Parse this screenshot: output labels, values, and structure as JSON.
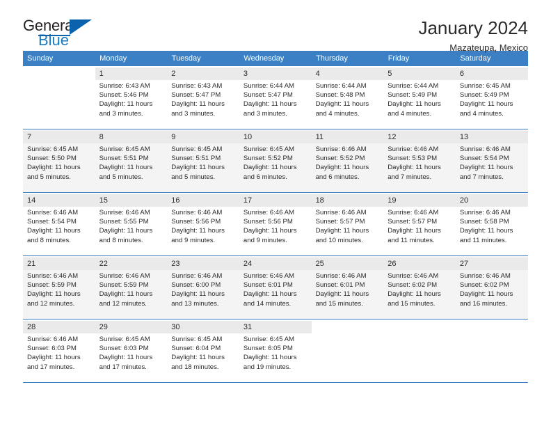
{
  "logo": {
    "primary": "General",
    "secondary": "Blue",
    "triangle_color": "#0b63ad",
    "secondary_color": "#1c7ac0"
  },
  "header": {
    "title": "January 2024",
    "subtitle": "Mazateupa, Mexico"
  },
  "theme": {
    "header_row_bg": "#3b80c4",
    "header_row_text": "#ffffff",
    "shaded_row_bg": "#f4f4f4",
    "daynum_bg": "#eaeaea",
    "grid_line": "#3b80c4"
  },
  "weekdays": [
    "Sunday",
    "Monday",
    "Tuesday",
    "Wednesday",
    "Thursday",
    "Friday",
    "Saturday"
  ],
  "weeks": [
    [
      {
        "day": "",
        "lines": []
      },
      {
        "day": "1",
        "lines": [
          "Sunrise: 6:43 AM",
          "Sunset: 5:46 PM",
          "Daylight: 11 hours",
          "and 3 minutes."
        ]
      },
      {
        "day": "2",
        "lines": [
          "Sunrise: 6:43 AM",
          "Sunset: 5:47 PM",
          "Daylight: 11 hours",
          "and 3 minutes."
        ]
      },
      {
        "day": "3",
        "lines": [
          "Sunrise: 6:44 AM",
          "Sunset: 5:47 PM",
          "Daylight: 11 hours",
          "and 3 minutes."
        ]
      },
      {
        "day": "4",
        "lines": [
          "Sunrise: 6:44 AM",
          "Sunset: 5:48 PM",
          "Daylight: 11 hours",
          "and 4 minutes."
        ]
      },
      {
        "day": "5",
        "lines": [
          "Sunrise: 6:44 AM",
          "Sunset: 5:49 PM",
          "Daylight: 11 hours",
          "and 4 minutes."
        ]
      },
      {
        "day": "6",
        "lines": [
          "Sunrise: 6:45 AM",
          "Sunset: 5:49 PM",
          "Daylight: 11 hours",
          "and 4 minutes."
        ]
      }
    ],
    [
      {
        "day": "7",
        "lines": [
          "Sunrise: 6:45 AM",
          "Sunset: 5:50 PM",
          "Daylight: 11 hours",
          "and 5 minutes."
        ]
      },
      {
        "day": "8",
        "lines": [
          "Sunrise: 6:45 AM",
          "Sunset: 5:51 PM",
          "Daylight: 11 hours",
          "and 5 minutes."
        ]
      },
      {
        "day": "9",
        "lines": [
          "Sunrise: 6:45 AM",
          "Sunset: 5:51 PM",
          "Daylight: 11 hours",
          "and 5 minutes."
        ]
      },
      {
        "day": "10",
        "lines": [
          "Sunrise: 6:45 AM",
          "Sunset: 5:52 PM",
          "Daylight: 11 hours",
          "and 6 minutes."
        ]
      },
      {
        "day": "11",
        "lines": [
          "Sunrise: 6:46 AM",
          "Sunset: 5:52 PM",
          "Daylight: 11 hours",
          "and 6 minutes."
        ]
      },
      {
        "day": "12",
        "lines": [
          "Sunrise: 6:46 AM",
          "Sunset: 5:53 PM",
          "Daylight: 11 hours",
          "and 7 minutes."
        ]
      },
      {
        "day": "13",
        "lines": [
          "Sunrise: 6:46 AM",
          "Sunset: 5:54 PM",
          "Daylight: 11 hours",
          "and 7 minutes."
        ]
      }
    ],
    [
      {
        "day": "14",
        "lines": [
          "Sunrise: 6:46 AM",
          "Sunset: 5:54 PM",
          "Daylight: 11 hours",
          "and 8 minutes."
        ]
      },
      {
        "day": "15",
        "lines": [
          "Sunrise: 6:46 AM",
          "Sunset: 5:55 PM",
          "Daylight: 11 hours",
          "and 8 minutes."
        ]
      },
      {
        "day": "16",
        "lines": [
          "Sunrise: 6:46 AM",
          "Sunset: 5:56 PM",
          "Daylight: 11 hours",
          "and 9 minutes."
        ]
      },
      {
        "day": "17",
        "lines": [
          "Sunrise: 6:46 AM",
          "Sunset: 5:56 PM",
          "Daylight: 11 hours",
          "and 9 minutes."
        ]
      },
      {
        "day": "18",
        "lines": [
          "Sunrise: 6:46 AM",
          "Sunset: 5:57 PM",
          "Daylight: 11 hours",
          "and 10 minutes."
        ]
      },
      {
        "day": "19",
        "lines": [
          "Sunrise: 6:46 AM",
          "Sunset: 5:57 PM",
          "Daylight: 11 hours",
          "and 11 minutes."
        ]
      },
      {
        "day": "20",
        "lines": [
          "Sunrise: 6:46 AM",
          "Sunset: 5:58 PM",
          "Daylight: 11 hours",
          "and 11 minutes."
        ]
      }
    ],
    [
      {
        "day": "21",
        "lines": [
          "Sunrise: 6:46 AM",
          "Sunset: 5:59 PM",
          "Daylight: 11 hours",
          "and 12 minutes."
        ]
      },
      {
        "day": "22",
        "lines": [
          "Sunrise: 6:46 AM",
          "Sunset: 5:59 PM",
          "Daylight: 11 hours",
          "and 12 minutes."
        ]
      },
      {
        "day": "23",
        "lines": [
          "Sunrise: 6:46 AM",
          "Sunset: 6:00 PM",
          "Daylight: 11 hours",
          "and 13 minutes."
        ]
      },
      {
        "day": "24",
        "lines": [
          "Sunrise: 6:46 AM",
          "Sunset: 6:01 PM",
          "Daylight: 11 hours",
          "and 14 minutes."
        ]
      },
      {
        "day": "25",
        "lines": [
          "Sunrise: 6:46 AM",
          "Sunset: 6:01 PM",
          "Daylight: 11 hours",
          "and 15 minutes."
        ]
      },
      {
        "day": "26",
        "lines": [
          "Sunrise: 6:46 AM",
          "Sunset: 6:02 PM",
          "Daylight: 11 hours",
          "and 15 minutes."
        ]
      },
      {
        "day": "27",
        "lines": [
          "Sunrise: 6:46 AM",
          "Sunset: 6:02 PM",
          "Daylight: 11 hours",
          "and 16 minutes."
        ]
      }
    ],
    [
      {
        "day": "28",
        "lines": [
          "Sunrise: 6:46 AM",
          "Sunset: 6:03 PM",
          "Daylight: 11 hours",
          "and 17 minutes."
        ]
      },
      {
        "day": "29",
        "lines": [
          "Sunrise: 6:45 AM",
          "Sunset: 6:03 PM",
          "Daylight: 11 hours",
          "and 17 minutes."
        ]
      },
      {
        "day": "30",
        "lines": [
          "Sunrise: 6:45 AM",
          "Sunset: 6:04 PM",
          "Daylight: 11 hours",
          "and 18 minutes."
        ]
      },
      {
        "day": "31",
        "lines": [
          "Sunrise: 6:45 AM",
          "Sunset: 6:05 PM",
          "Daylight: 11 hours",
          "and 19 minutes."
        ]
      },
      {
        "day": "",
        "lines": []
      },
      {
        "day": "",
        "lines": []
      },
      {
        "day": "",
        "lines": []
      }
    ]
  ]
}
